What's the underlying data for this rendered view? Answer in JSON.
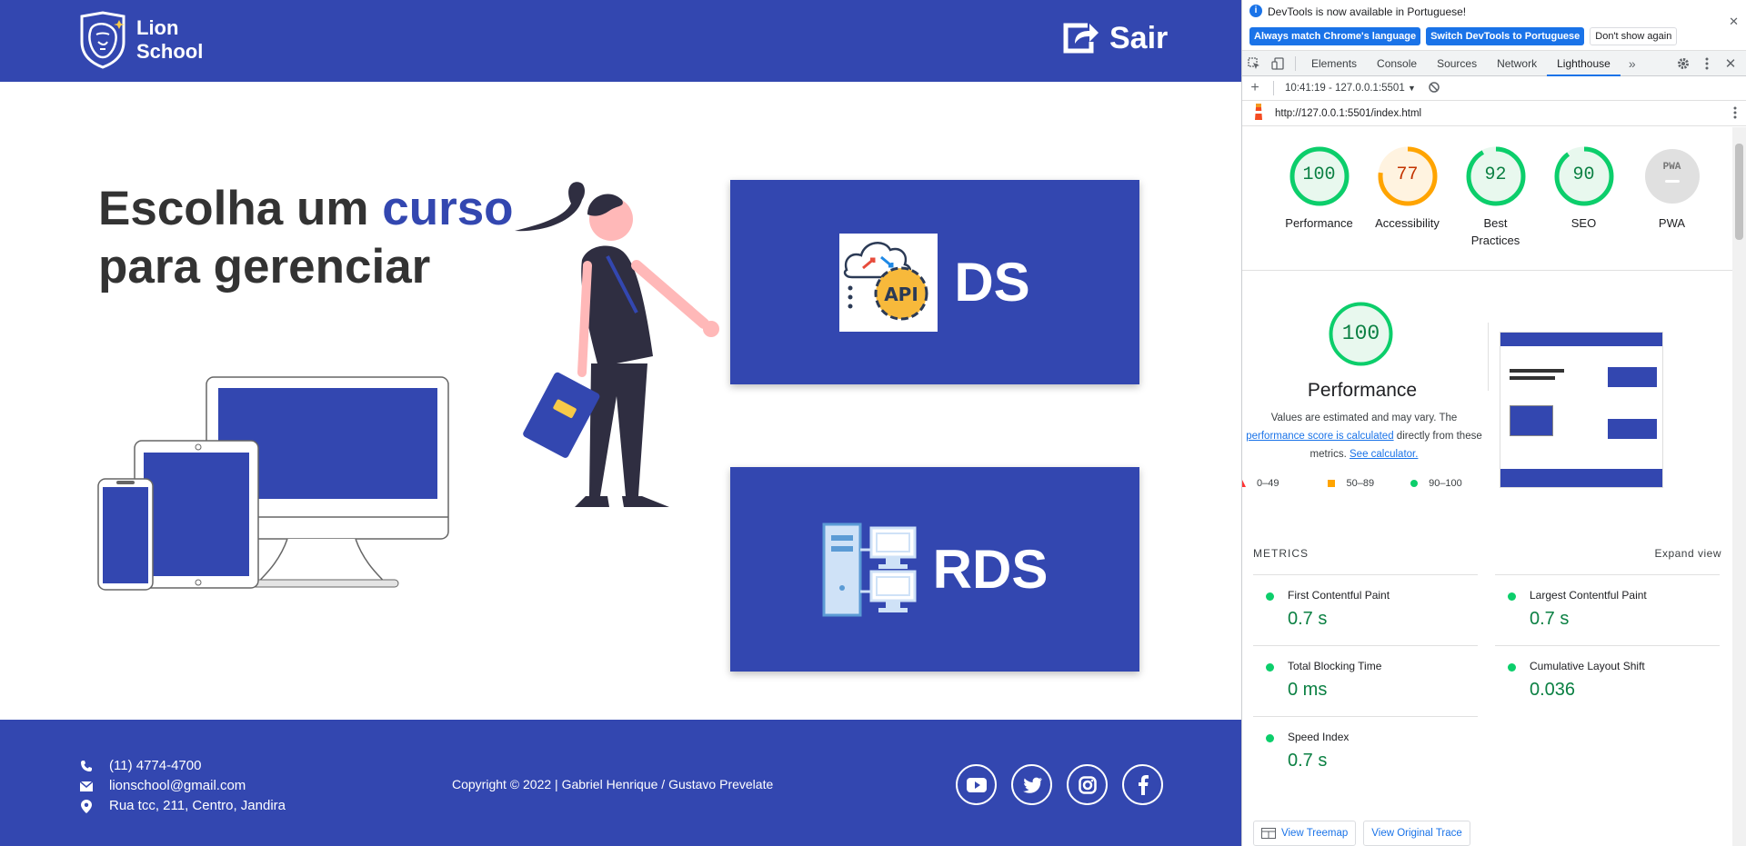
{
  "site": {
    "logo_line1": "Lion",
    "logo_line2": "School",
    "logout_label": "Sair",
    "headline_part1": "Escolha um",
    "headline_accent": "curso",
    "headline_part2": "para gerenciar",
    "cards": [
      {
        "label": "DS",
        "icon": "api-cloud-gear-icon"
      },
      {
        "label": "RDS",
        "icon": "network-computers-icon"
      }
    ],
    "footer": {
      "phone": "(11) 4774-4700",
      "email": "lionschool@gmail.com",
      "address": "Rua tcc, 211, Centro, Jandira",
      "copyright": "Copyright © 2022 | Gabriel Henrique / Gustavo Prevelate",
      "socials": [
        "youtube-icon",
        "twitter-icon",
        "instagram-icon",
        "facebook-icon"
      ]
    },
    "colors": {
      "brand": "#3347b0",
      "text": "#333333"
    }
  },
  "devtools": {
    "infobar": {
      "message": "DevTools is now available in Portuguese!",
      "btn_match": "Always match Chrome's language",
      "btn_switch": "Switch DevTools to Portuguese",
      "btn_dismiss": "Don't show again"
    },
    "tabs": [
      "Elements",
      "Console",
      "Sources",
      "Network",
      "Lighthouse"
    ],
    "active_tab": "Lighthouse",
    "report_time": "10:41:19 - 127.0.0.1:5501",
    "report_url": "http://127.0.0.1:5501/index.html",
    "scores": [
      {
        "label": "Performance",
        "value": 100,
        "display": "100",
        "color": "#0cce6b",
        "text_color": "#0b8043"
      },
      {
        "label": "Accessibility",
        "value": 77,
        "display": "77",
        "color": "#ffa400",
        "text_color": "#c33300"
      },
      {
        "label": "Best Practices",
        "value": 92,
        "display": "92",
        "color": "#0cce6b",
        "text_color": "#0b8043"
      },
      {
        "label": "SEO",
        "value": 90,
        "display": "90",
        "color": "#0cce6b",
        "text_color": "#0b8043"
      },
      {
        "label": "PWA",
        "value": null,
        "display": "PWA",
        "color": "#9e9e9e",
        "text_color": "#757575"
      }
    ],
    "performance": {
      "score": "100",
      "title": "Performance",
      "note_1": "Values are estimated and may vary. The",
      "note_link": "performance score is calculated",
      "note_2": "directly from these",
      "note_3": "metrics.",
      "note_calc": "See calculator.",
      "legend": [
        "0–49",
        "50–89",
        "90–100"
      ]
    },
    "metrics_label": "METRICS",
    "expand_label": "Expand view",
    "metrics": [
      {
        "name": "First Contentful Paint",
        "value": "0.7 s"
      },
      {
        "name": "Largest Contentful Paint",
        "value": "0.7 s"
      },
      {
        "name": "Total Blocking Time",
        "value": "0 ms"
      },
      {
        "name": "Cumulative Layout Shift",
        "value": "0.036"
      },
      {
        "name": "Speed Index",
        "value": "0.7 s"
      }
    ],
    "view_treemap": "View Treemap",
    "view_trace": "View Original Trace"
  }
}
